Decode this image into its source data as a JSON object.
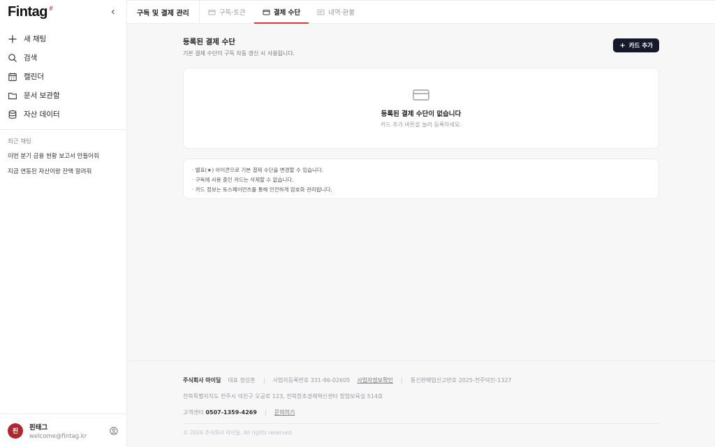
{
  "brand": {
    "logo": "Fintag",
    "logo_mark": "#"
  },
  "sidebar": {
    "nav": [
      {
        "icon": "plus-icon",
        "label": "새 채팅"
      },
      {
        "icon": "search-icon",
        "label": "검색"
      },
      {
        "icon": "calendar-icon",
        "label": "캘린더"
      },
      {
        "icon": "folder-icon",
        "label": "문서 보관함"
      },
      {
        "icon": "database-icon",
        "label": "자산 데이터"
      }
    ],
    "recent_title": "최근 채팅",
    "recent": [
      "이번 분기 금융 현황 보고서 만들어줘",
      "지금 연동된 자산이랑 잔액 알려줘"
    ],
    "user": {
      "avatar_text": "핀",
      "name": "핀태그",
      "email": "welcome@fintag.kr"
    }
  },
  "header": {
    "section_title": "구독 및 결제 관리",
    "tabs": [
      {
        "label": "구독·토큰",
        "icon": "card-icon",
        "active": false
      },
      {
        "label": "결제 수단",
        "icon": "wallet-icon",
        "active": true
      },
      {
        "label": "내역·환불",
        "icon": "receipt-icon",
        "active": false
      }
    ]
  },
  "main": {
    "title": "등록된 결제 수단",
    "subtitle": "기본 결제 수단이 구독 자동 갱신 시 사용됩니다.",
    "add_button": "카드 추가",
    "empty_title": "등록된 결제 수단이 없습니다",
    "empty_sub": "카드 추가 버튼을 눌러 등록하세요.",
    "notes": [
      "· 별표(★) 아이콘으로 기본 결제 수단을 변경할 수 있습니다.",
      "· 구독에 사용 중인 카드는 삭제할 수 없습니다.",
      "· 카드 정보는 토스페이먼츠를 통해 안전하게 암호화 관리됩니다."
    ]
  },
  "footer": {
    "company": "주식회사 마이딜",
    "ceo": "대표 정상훈",
    "biz_no": "사업자등록번호 331-86-02605",
    "biz_link": "사업자정보확인",
    "mail_order": "통신판매업신고번호 2025-전주덕진-1327",
    "address": "전북특별자치도 전주시 덕진구 오공로 123, 전북창조경제혁신센터 창업보육실 514호",
    "cs_label": "고객센터",
    "cs_phone": "0507-1359-4269",
    "contact_link": "문의하기",
    "copyright": "© 2026 주식회사 마이딜. All rights reserved."
  },
  "colors": {
    "accent": "#d63a3a",
    "button_dark": "#16192b",
    "avatar": "#b3262d"
  }
}
